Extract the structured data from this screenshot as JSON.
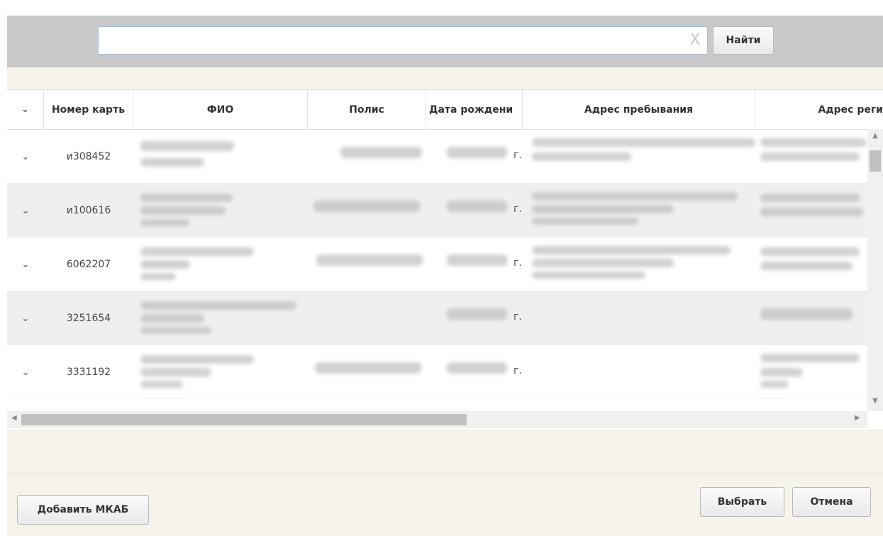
{
  "search": {
    "value": "",
    "placeholder": "",
    "clear_glyph": "X",
    "find_label": "Найти"
  },
  "grid": {
    "columns": [
      "Номер карть",
      "ФИО",
      "Полис",
      "Дата рождени",
      "Адрес пребывания",
      "Адрес реги"
    ],
    "rows": [
      {
        "card_number": "и308452",
        "year_suffix": "г."
      },
      {
        "card_number": "и100616",
        "year_suffix": "г."
      },
      {
        "card_number": "6062207",
        "year_suffix": "г."
      },
      {
        "card_number": "3251654",
        "year_suffix": "г."
      },
      {
        "card_number": "3331192",
        "year_suffix": "г."
      }
    ]
  },
  "footer": {
    "add_label": "Добавить МКАБ",
    "select_label": "Выбрать",
    "cancel_label": "Отмена"
  },
  "icons": {
    "expand": "chevron-down-icon",
    "clear": "clear-icon"
  },
  "colors": {
    "toolbar": "#c9c9c9",
    "dialog_bg": "#f5f3ea",
    "alt_row": "#efefef"
  }
}
